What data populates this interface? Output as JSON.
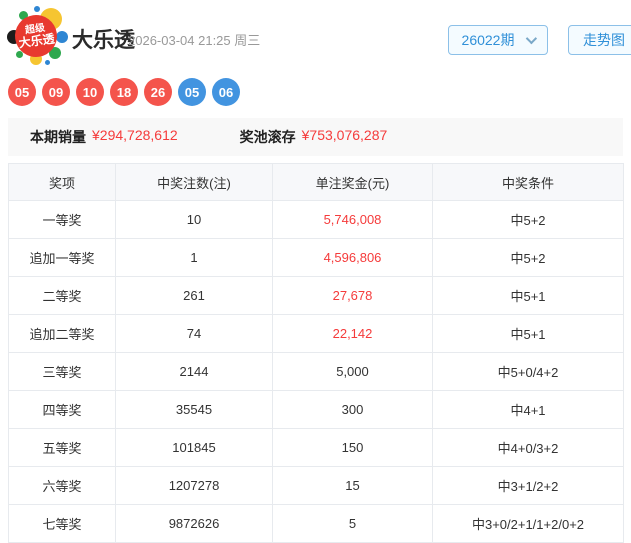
{
  "header": {
    "logo": {
      "line1": "超级",
      "line2": "大乐透"
    },
    "title": "大乐透",
    "datetime": "2026-03-04 21:25 周三",
    "period_selector": {
      "value": "26022期"
    },
    "trend_button_label": "走势图"
  },
  "draw": {
    "front_numbers": [
      "05",
      "09",
      "10",
      "18",
      "26"
    ],
    "back_numbers": [
      "05",
      "06"
    ],
    "front_color": "#f4544c",
    "back_color": "#4294e0"
  },
  "summary": {
    "sales_label": "本期销量",
    "sales_value": "¥294,728,612",
    "pool_label": "奖池滚存",
    "pool_value": "¥753,076,287"
  },
  "table": {
    "headers": [
      "奖项",
      "中奖注数(注)",
      "单注奖金(元)",
      "中奖条件"
    ],
    "rows": [
      {
        "prize": "一等奖",
        "count": "10",
        "amount": "5,746,008",
        "condition": "中5+2",
        "highlight": true
      },
      {
        "prize": "追加一等奖",
        "count": "1",
        "amount": "4,596,806",
        "condition": "中5+2",
        "highlight": true
      },
      {
        "prize": "二等奖",
        "count": "261",
        "amount": "27,678",
        "condition": "中5+1",
        "highlight": true
      },
      {
        "prize": "追加二等奖",
        "count": "74",
        "amount": "22,142",
        "condition": "中5+1",
        "highlight": true
      },
      {
        "prize": "三等奖",
        "count": "2144",
        "amount": "5,000",
        "condition": "中5+0/4+2",
        "highlight": false
      },
      {
        "prize": "四等奖",
        "count": "35545",
        "amount": "300",
        "condition": "中4+1",
        "highlight": false
      },
      {
        "prize": "五等奖",
        "count": "101845",
        "amount": "150",
        "condition": "中4+0/3+2",
        "highlight": false
      },
      {
        "prize": "六等奖",
        "count": "1207278",
        "amount": "15",
        "condition": "中3+1/2+2",
        "highlight": false
      },
      {
        "prize": "七等奖",
        "count": "9872626",
        "amount": "5",
        "condition": "中3+0/2+1/1+2/0+2",
        "highlight": false
      }
    ]
  },
  "colors": {
    "red": "#f53b3b",
    "accent_blue": "#3090d8"
  }
}
